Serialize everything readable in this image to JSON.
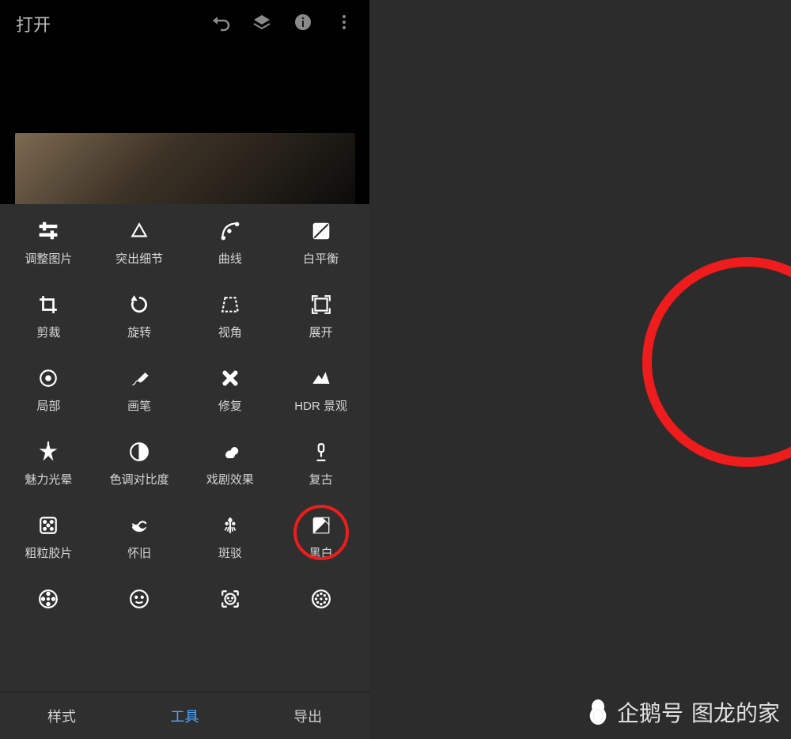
{
  "header": {
    "open_label": "打开",
    "icons": [
      "undo-icon",
      "layers-icon",
      "info-icon",
      "more-icon"
    ]
  },
  "tools": [
    {
      "id": "tune",
      "label": "调整图片"
    },
    {
      "id": "details",
      "label": "突出细节"
    },
    {
      "id": "curves",
      "label": "曲线"
    },
    {
      "id": "wb",
      "label": "白平衡"
    },
    {
      "id": "crop",
      "label": "剪裁"
    },
    {
      "id": "rotate",
      "label": "旋转"
    },
    {
      "id": "perspective",
      "label": "视角"
    },
    {
      "id": "expand",
      "label": "展开"
    },
    {
      "id": "selective",
      "label": "局部"
    },
    {
      "id": "brush",
      "label": "画笔"
    },
    {
      "id": "healing",
      "label": "修复"
    },
    {
      "id": "hdr",
      "label": "HDR 景观"
    },
    {
      "id": "glamour",
      "label": "魅力光晕"
    },
    {
      "id": "tonal",
      "label": "色调对比度"
    },
    {
      "id": "drama",
      "label": "戏剧效果"
    },
    {
      "id": "vintage",
      "label": "复古"
    },
    {
      "id": "grainy",
      "label": "粗粒胶片"
    },
    {
      "id": "retrolux",
      "label": "怀旧"
    },
    {
      "id": "grunge",
      "label": "斑驳"
    },
    {
      "id": "bw",
      "label": "黑白",
      "highlighted": true
    },
    {
      "id": "film",
      "label": ""
    },
    {
      "id": "face",
      "label": ""
    },
    {
      "id": "portrait",
      "label": ""
    },
    {
      "id": "pose",
      "label": ""
    }
  ],
  "tabs": [
    {
      "id": "styles",
      "label": "样式",
      "active": false
    },
    {
      "id": "tools",
      "label": "工具",
      "active": true
    },
    {
      "id": "export",
      "label": "导出",
      "active": false
    }
  ],
  "zoom": {
    "label": "黑白"
  },
  "watermark": {
    "brand": "企鹅号",
    "author": "图龙的家"
  },
  "colors": {
    "highlight": "#ee1c1c",
    "accent": "#4aa7ff",
    "bg": "#2c2c2c"
  }
}
